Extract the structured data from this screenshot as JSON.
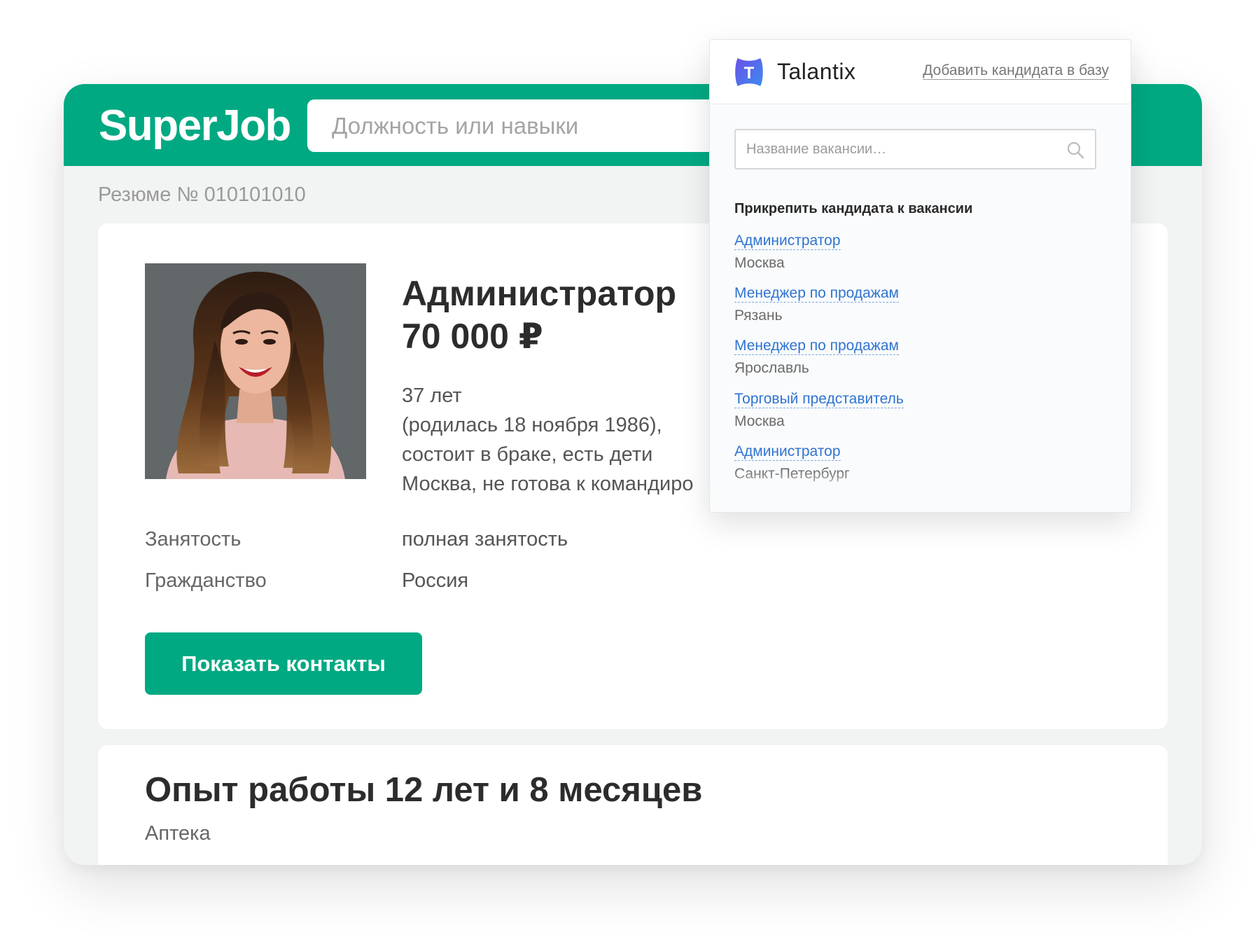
{
  "superjob": {
    "logo": "SuperJob",
    "search_placeholder": "Должность или навыки"
  },
  "resume": {
    "number_label": "Резюме № 010101010",
    "title": "Администратор",
    "salary": "70 000 ₽",
    "age": "37 лет",
    "birth": "(родилась 18 ноября 1986),",
    "family": "состоит в браке, есть дети",
    "location": "Москва,  не готова к командиро",
    "fields": [
      {
        "label": "Занятость",
        "value": "полная занятость"
      },
      {
        "label": "Гражданство",
        "value": "Россия"
      }
    ],
    "show_contacts_button": "Показать контакты"
  },
  "experience": {
    "title": "Опыт работы 12 лет и 8 месяцев",
    "company": "Аптека"
  },
  "talantix": {
    "logo_letter": "T",
    "brand": "Talantix",
    "add_candidate_link": "Добавить кандидата в базу",
    "vacancy_search_placeholder": "Название вакансии…",
    "attach_title": "Прикрепить кандидата к вакансии",
    "vacancies": [
      {
        "title": "Администратор",
        "city": "Москва"
      },
      {
        "title": "Менеджер по продажам",
        "city": "Рязань"
      },
      {
        "title": "Менеджер по продажам",
        "city": "Ярославль"
      },
      {
        "title": "Торговый представитель",
        "city": "Москва"
      },
      {
        "title": "Администратор",
        "city": "Санкт-Петербург"
      }
    ]
  },
  "colors": {
    "brand_green": "#00a982",
    "talantix_link": "#2f74d0",
    "talantix_logo_start": "#5b4fe0",
    "talantix_logo_end": "#3f8bf0"
  },
  "icons": {
    "search": "search-icon",
    "talantix_logo": "talantix-logo-icon"
  }
}
